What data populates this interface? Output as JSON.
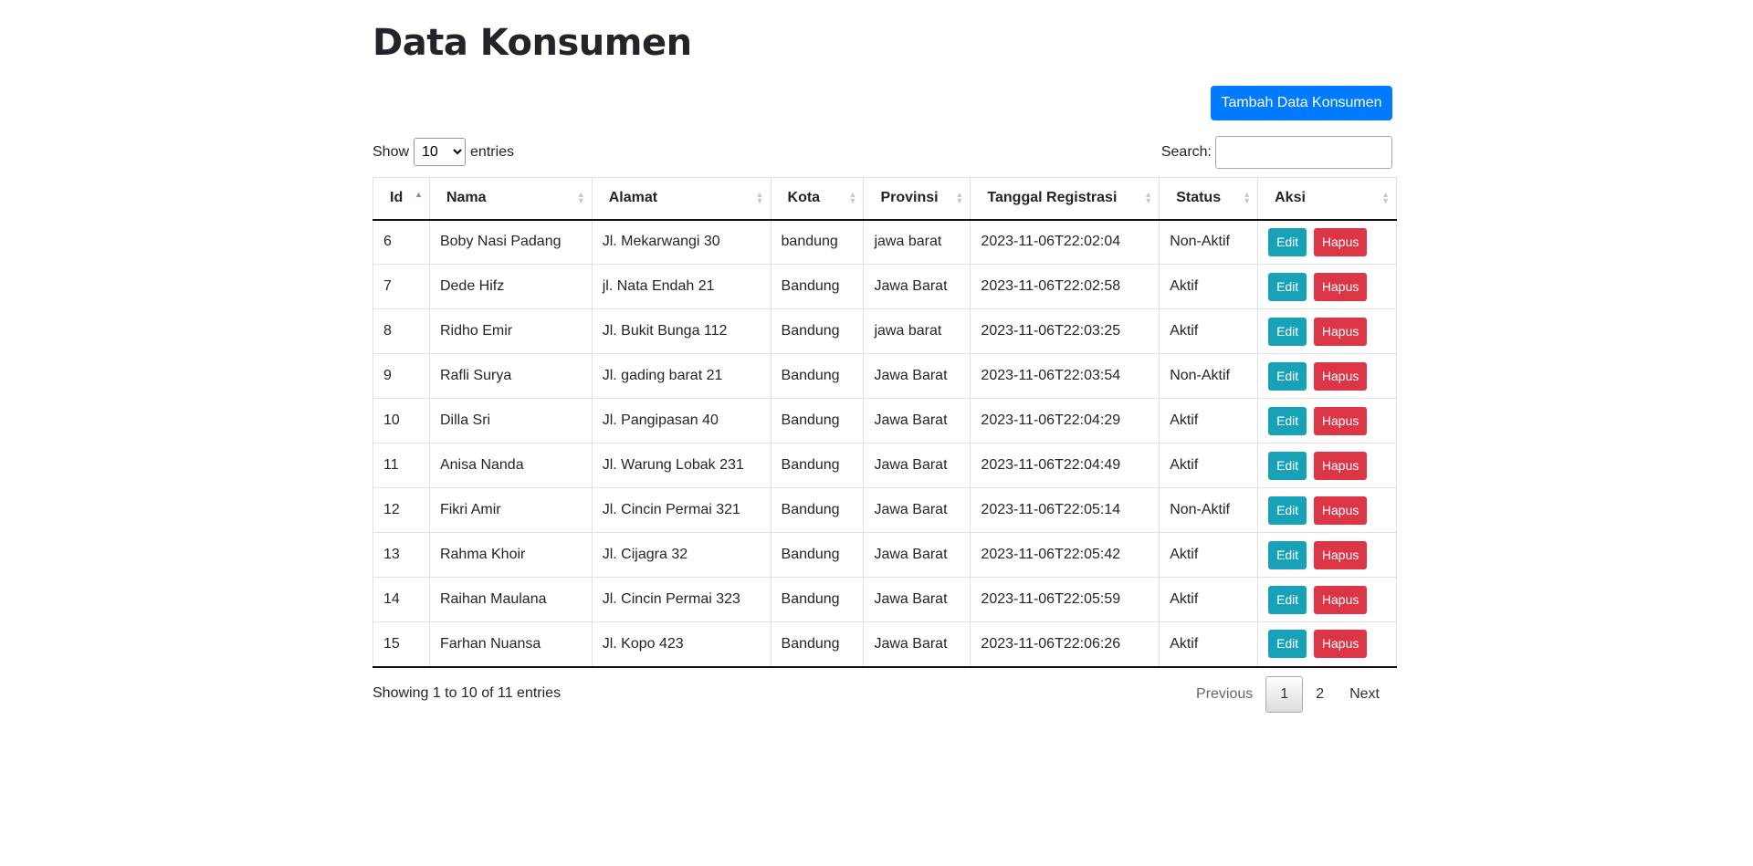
{
  "page": {
    "title": "Data Konsumen"
  },
  "toolbar": {
    "add_label": "Tambah Data Konsumen"
  },
  "length": {
    "show_label": "Show",
    "selected": "10",
    "entries_label": "entries"
  },
  "search": {
    "label": "Search:",
    "value": "",
    "placeholder": ""
  },
  "table": {
    "headers": [
      "Id",
      "Nama",
      "Alamat",
      "Kota",
      "Provinsi",
      "Tanggal Registrasi",
      "Status",
      "Aksi"
    ],
    "sorted_column": "Id",
    "sort_direction": "ascending",
    "rows": [
      [
        "6",
        "Boby Nasi Padang",
        "Jl. Mekarwangi 30",
        "bandung",
        "jawa barat",
        "2023-11-06T22:02:04",
        "Non-Aktif"
      ],
      [
        "7",
        "Dede Hifz",
        "jl. Nata Endah 21",
        "Bandung",
        "Jawa Barat",
        "2023-11-06T22:02:58",
        "Aktif"
      ],
      [
        "8",
        "Ridho Emir",
        "Jl. Bukit Bunga 112",
        "Bandung",
        "jawa barat",
        "2023-11-06T22:03:25",
        "Aktif"
      ],
      [
        "9",
        "Rafli Surya",
        "Jl. gading barat 21",
        "Bandung",
        "Jawa Barat",
        "2023-11-06T22:03:54",
        "Non-Aktif"
      ],
      [
        "10",
        "Dilla Sri",
        "Jl. Pangipasan 40",
        "Bandung",
        "Jawa Barat",
        "2023-11-06T22:04:29",
        "Aktif"
      ],
      [
        "11",
        "Anisa Nanda",
        "Jl. Warung Lobak 231",
        "Bandung",
        "Jawa Barat",
        "2023-11-06T22:04:49",
        "Aktif"
      ],
      [
        "12",
        "Fikri Amir",
        "Jl. Cincin Permai 321",
        "Bandung",
        "Jawa Barat",
        "2023-11-06T22:05:14",
        "Non-Aktif"
      ],
      [
        "13",
        "Rahma Khoir",
        "Jl. Cijagra 32",
        "Bandung",
        "Jawa Barat",
        "2023-11-06T22:05:42",
        "Aktif"
      ],
      [
        "14",
        "Raihan Maulana",
        "Jl. Cincin Permai 323",
        "Bandung",
        "Jawa Barat",
        "2023-11-06T22:05:59",
        "Aktif"
      ],
      [
        "15",
        "Farhan Nuansa",
        "Jl. Kopo 423",
        "Bandung",
        "Jawa Barat",
        "2023-11-06T22:06:26",
        "Aktif"
      ]
    ],
    "edit_label": "Edit",
    "delete_label": "Hapus"
  },
  "info": {
    "text": "Showing 1 to 10 of 11 entries"
  },
  "pagination": {
    "previous": "Previous",
    "pages": [
      "1",
      "2"
    ],
    "current": "1",
    "next": "Next"
  },
  "colors": {
    "primary": "#007bff",
    "info": "#17a2b8",
    "danger": "#dc3545",
    "text": "#212529"
  }
}
